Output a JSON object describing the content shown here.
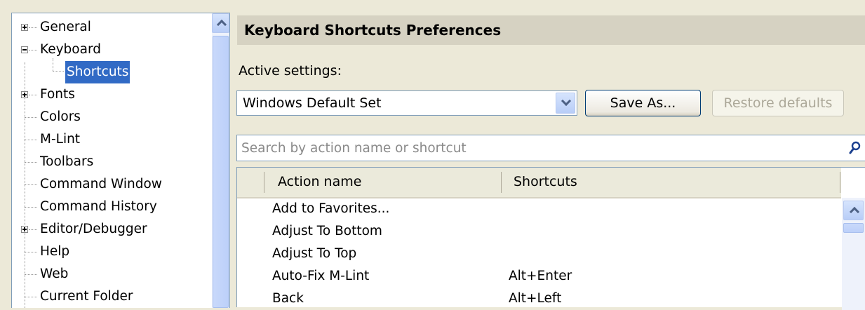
{
  "tree": {
    "items": [
      {
        "label": "General",
        "expander": "plus"
      },
      {
        "label": "Keyboard",
        "expander": "minus"
      },
      {
        "label": "Shortcuts",
        "selected": true
      },
      {
        "label": "Fonts",
        "expander": "plus"
      },
      {
        "label": "Colors"
      },
      {
        "label": "M-Lint"
      },
      {
        "label": "Toolbars"
      },
      {
        "label": "Command Window"
      },
      {
        "label": "Command History"
      },
      {
        "label": "Editor/Debugger",
        "expander": "plus"
      },
      {
        "label": "Help"
      },
      {
        "label": "Web"
      },
      {
        "label": "Current Folder"
      }
    ]
  },
  "header": {
    "title": "Keyboard Shortcuts Preferences"
  },
  "settings": {
    "label": "Active settings:",
    "selected": "Windows Default Set",
    "save_as": "Save As...",
    "restore_defaults": "Restore defaults"
  },
  "search": {
    "placeholder": "Search by action name or shortcut"
  },
  "table": {
    "columns": [
      "Action name",
      "Shortcuts"
    ],
    "rows": [
      [
        "Add to Favorites...",
        ""
      ],
      [
        "Adjust To Bottom",
        ""
      ],
      [
        "Adjust To Top",
        ""
      ],
      [
        "Auto-Fix M-Lint",
        "Alt+Enter"
      ],
      [
        "Back",
        "Alt+Left"
      ]
    ]
  },
  "icons": {
    "search": "search-icon",
    "dropdown": "chevron-down-icon",
    "scroll_up": "chevron-up-icon",
    "expand": "plus-icon",
    "collapse": "minus-icon"
  },
  "colors": {
    "selection": "#316ac5",
    "header_bg": "#d6d2c2",
    "window_bg": "#ece9d8",
    "disabled_text": "#aca899"
  }
}
